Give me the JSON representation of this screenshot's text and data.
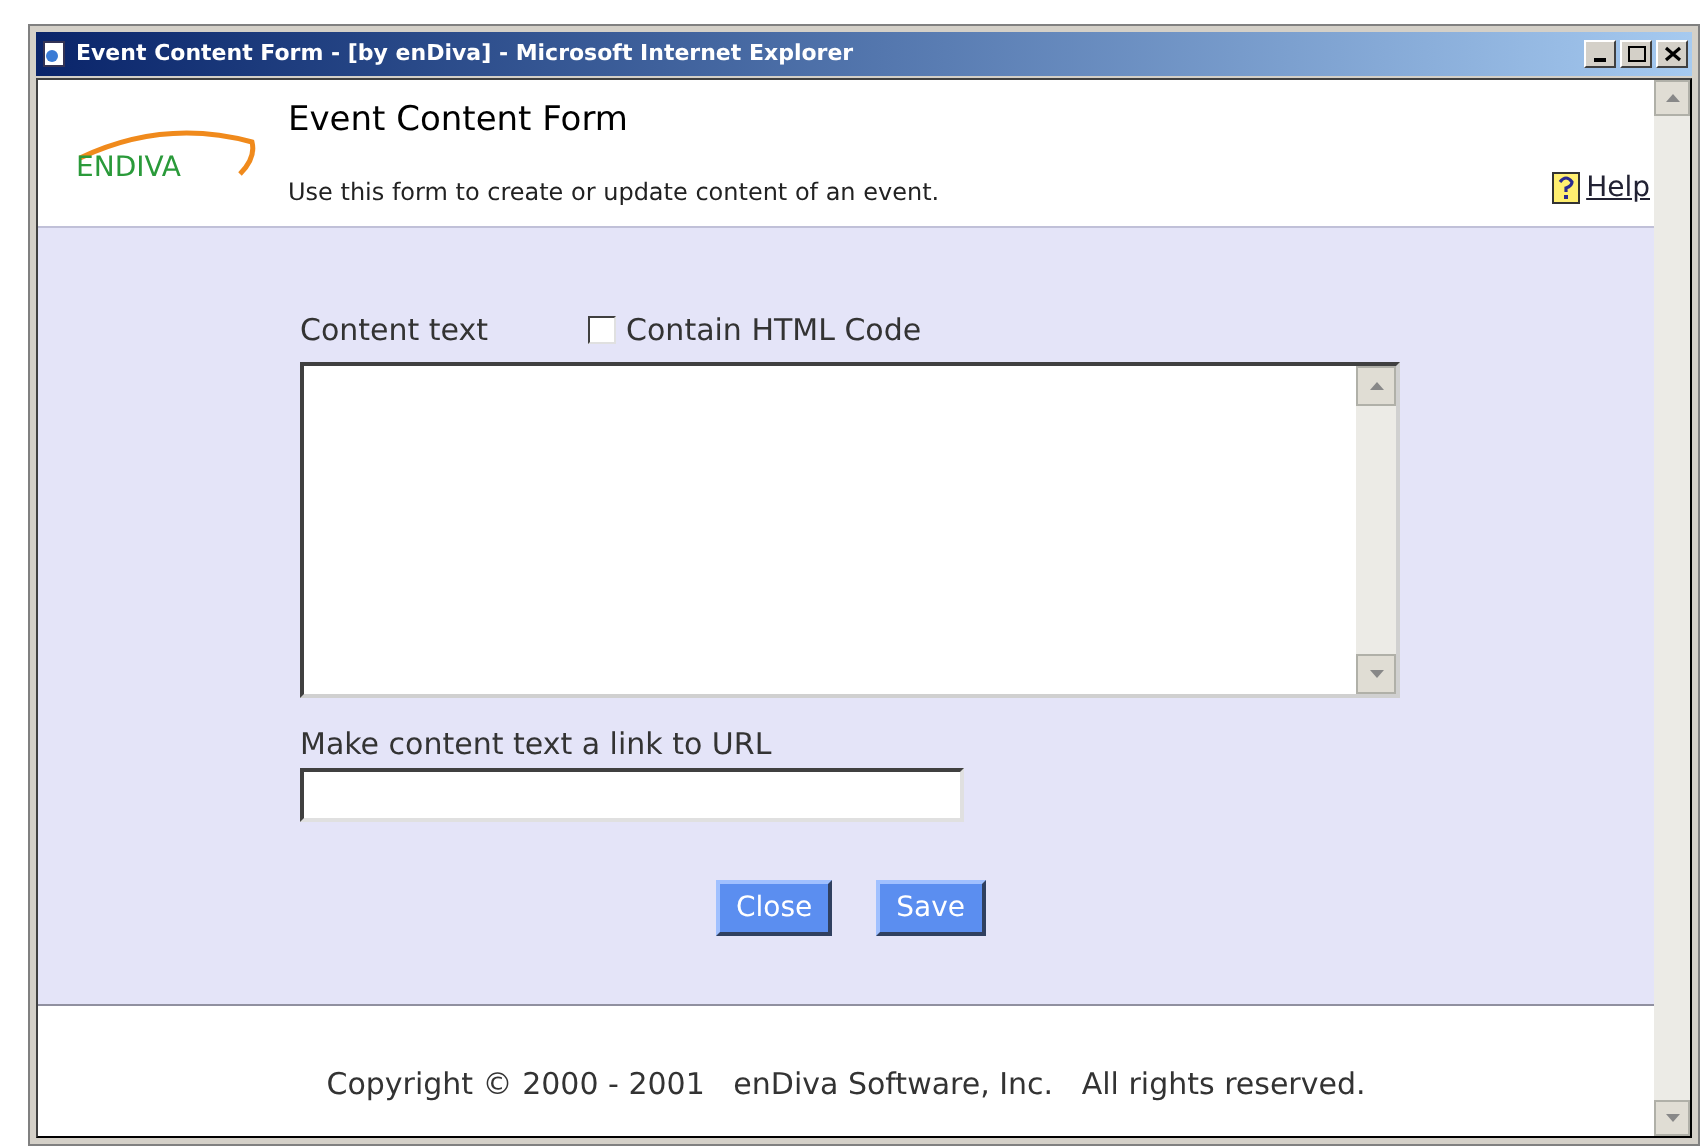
{
  "window": {
    "title": "Event Content Form - [by enDiva] - Microsoft Internet Explorer"
  },
  "header": {
    "logo": "ENDIVA",
    "title": "Event Content Form",
    "subtitle": "Use this form to create or update content of an event.",
    "help": "Help"
  },
  "form": {
    "content_label": "Content text",
    "html_checkbox": {
      "label": "Contain HTML Code",
      "checked": false
    },
    "url_label": "Make content text a link to URL"
  },
  "buttons": [
    "Close",
    "Save"
  ],
  "footer": "Copyright © 2000 - 2001   enDiva Software, Inc.   All rights reserved."
}
